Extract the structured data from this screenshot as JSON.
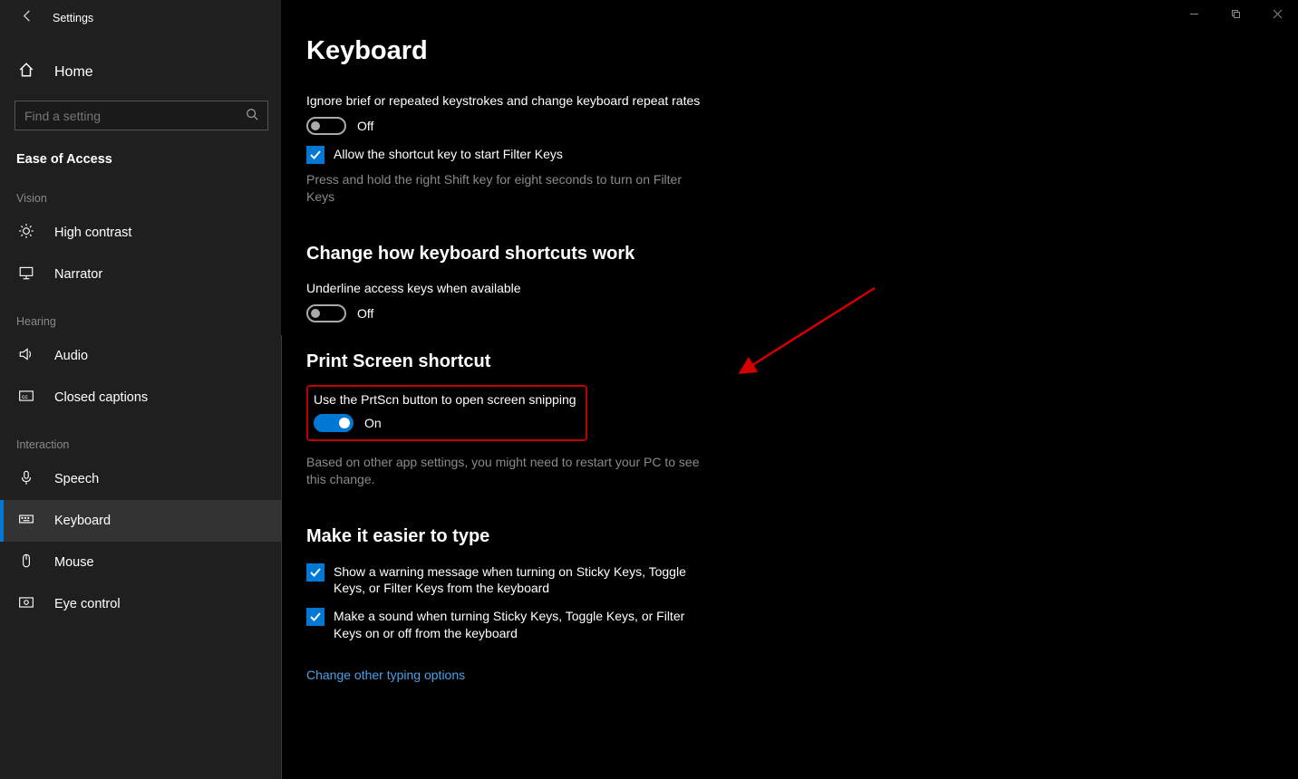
{
  "window": {
    "title": "Settings"
  },
  "sidebar": {
    "home": "Home",
    "search_placeholder": "Find a setting",
    "category": "Ease of Access",
    "groups": {
      "vision": "Vision",
      "hearing": "Hearing",
      "interaction": "Interaction"
    },
    "items": {
      "high_contrast": "High contrast",
      "narrator": "Narrator",
      "audio": "Audio",
      "closed_captions": "Closed captions",
      "speech": "Speech",
      "keyboard": "Keyboard",
      "mouse": "Mouse",
      "eye_control": "Eye control"
    }
  },
  "main": {
    "title": "Keyboard",
    "filter_keys_label": "Ignore brief or repeated keystrokes and change keyboard repeat rates",
    "filter_keys_state": "Off",
    "filter_shortcut_checkbox": "Allow the shortcut key to start Filter Keys",
    "filter_shortcut_desc": "Press and hold the right Shift key for eight seconds to turn on Filter Keys",
    "shortcuts_heading": "Change how keyboard shortcuts work",
    "underline_label": "Underline access keys when available",
    "underline_state": "Off",
    "prtscr_heading": "Print Screen shortcut",
    "prtscr_label": "Use the PrtScn button to open screen snipping",
    "prtscr_state": "On",
    "prtscr_desc": "Based on other app settings, you might need to restart your PC to see this change.",
    "type_heading": "Make it easier to type",
    "warn_checkbox": "Show a warning message when turning on Sticky Keys, Toggle Keys, or Filter Keys from the keyboard",
    "sound_checkbox": "Make a sound when turning Sticky Keys, Toggle Keys, or Filter Keys on or off from the keyboard",
    "other_link": "Change other typing options"
  }
}
